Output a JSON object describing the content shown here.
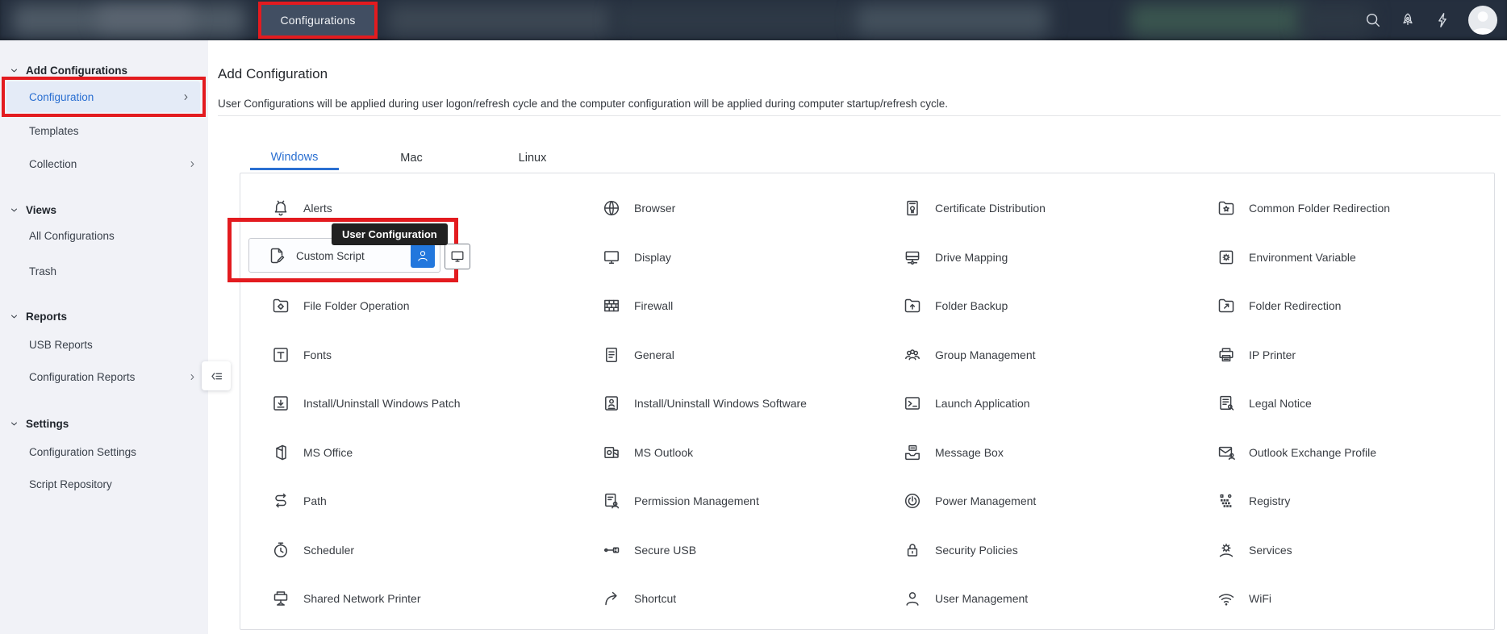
{
  "colors": {
    "highlight_red": "#e31b1f",
    "active_blue": "#2a6fd1",
    "user_button_blue": "#2277dd",
    "tooltip_bg": "#212121",
    "topbar_bg": "#252f3e"
  },
  "topbar": {
    "active_tab": "Configurations",
    "right_icons": [
      "search-icon",
      "launcher-icon",
      "flash-icon",
      "user-avatar"
    ]
  },
  "sidebar": {
    "sections": [
      {
        "label": "Add Configurations",
        "items": [
          {
            "label": "Configuration",
            "active": true,
            "chevron": true,
            "red_highlight": true
          },
          {
            "label": "Templates"
          },
          {
            "label": "Collection",
            "chevron": true
          }
        ]
      },
      {
        "label": "Views",
        "items": [
          {
            "label": "All Configurations"
          },
          {
            "label": "Trash"
          }
        ]
      },
      {
        "label": "Reports",
        "items": [
          {
            "label": "USB Reports"
          },
          {
            "label": "Configuration Reports",
            "chevron": true,
            "collapse_toggle": true
          }
        ]
      },
      {
        "label": "Settings",
        "items": [
          {
            "label": "Configuration Settings"
          },
          {
            "label": "Script Repository"
          }
        ]
      }
    ]
  },
  "main": {
    "title": "Add Configuration",
    "description": "User Configurations will be applied during user logon/refresh cycle and the computer configuration will be applied during computer startup/refresh cycle.",
    "tabs": [
      {
        "label": "Windows",
        "active": true
      },
      {
        "label": "Mac",
        "active": false
      },
      {
        "label": "Linux",
        "active": false
      }
    ],
    "custom_script": {
      "label": "Custom Script",
      "icon": "script-icon",
      "tooltip": "User Configuration",
      "buttons": [
        {
          "name": "user-configuration-button",
          "icon": "user-icon"
        },
        {
          "name": "computer-configuration-button",
          "icon": "monitor-icon"
        }
      ]
    },
    "grid": {
      "columns": [
        [
          {
            "label": "Alerts",
            "icon": "bell-icon"
          },
          {
            "label": "Custom Script",
            "special": true
          },
          {
            "label": "File Folder Operation",
            "icon": "folder-gear-icon"
          },
          {
            "label": "Fonts",
            "icon": "fonts-icon"
          },
          {
            "label": "Install/Uninstall Windows Patch",
            "icon": "patch-icon"
          },
          {
            "label": "MS Office",
            "icon": "office-icon"
          },
          {
            "label": "Path",
            "icon": "path-icon"
          },
          {
            "label": "Scheduler",
            "icon": "scheduler-icon"
          },
          {
            "label": "Shared Network Printer",
            "icon": "network-printer-icon"
          }
        ],
        [
          {
            "label": "Browser",
            "icon": "globe-icon"
          },
          {
            "label": "Display",
            "icon": "display-icon"
          },
          {
            "label": "Firewall",
            "icon": "firewall-icon"
          },
          {
            "label": "General",
            "icon": "document-icon"
          },
          {
            "label": "Install/Uninstall Windows Software",
            "icon": "software-icon"
          },
          {
            "label": "MS Outlook",
            "icon": "outlook-icon"
          },
          {
            "label": "Permission Management",
            "icon": "permission-icon"
          },
          {
            "label": "Secure USB",
            "icon": "usb-icon"
          },
          {
            "label": "Shortcut",
            "icon": "shortcut-icon"
          }
        ],
        [
          {
            "label": "Certificate Distribution",
            "icon": "certificate-icon"
          },
          {
            "label": "Drive Mapping",
            "icon": "drive-icon"
          },
          {
            "label": "Folder Backup",
            "icon": "folder-backup-icon"
          },
          {
            "label": "Group Management",
            "icon": "group-icon"
          },
          {
            "label": "Launch Application",
            "icon": "terminal-icon"
          },
          {
            "label": "Message Box",
            "icon": "message-box-icon"
          },
          {
            "label": "Power Management",
            "icon": "power-icon"
          },
          {
            "label": "Security Policies",
            "icon": "lock-icon"
          },
          {
            "label": "User Management",
            "icon": "user-icon"
          }
        ],
        [
          {
            "label": "Common Folder Redirection",
            "icon": "folder-star-icon"
          },
          {
            "label": "Environment Variable",
            "icon": "env-variable-icon"
          },
          {
            "label": "Folder Redirection",
            "icon": "folder-redirect-icon"
          },
          {
            "label": "IP Printer",
            "icon": "printer-icon"
          },
          {
            "label": "Legal Notice",
            "icon": "legal-icon"
          },
          {
            "label": "Outlook Exchange Profile",
            "icon": "mail-profile-icon"
          },
          {
            "label": "Registry",
            "icon": "registry-icon"
          },
          {
            "label": "Services",
            "icon": "services-icon"
          },
          {
            "label": "WiFi",
            "icon": "wifi-icon"
          }
        ]
      ]
    }
  }
}
